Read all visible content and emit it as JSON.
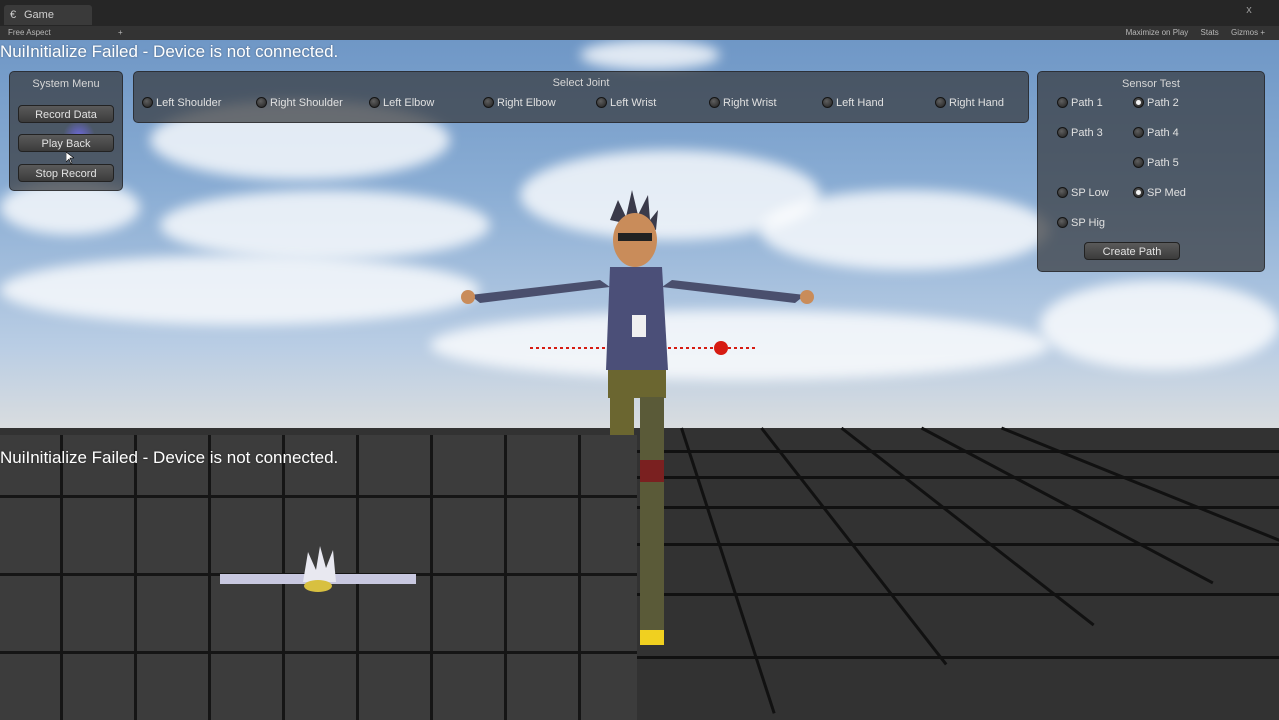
{
  "window": {
    "tab_label": "Game",
    "tab_icon": "€",
    "close_glyph": "x"
  },
  "toolbar": {
    "aspect": "Free Aspect",
    "aspect_arrow": "+",
    "maximize": "Maximize on Play",
    "stats": "Stats",
    "gizmos": "Gizmos +"
  },
  "status": {
    "error_main": "NuiInitialize Failed - Device is not connected.",
    "error_minimap": "NuiInitialize Failed - Device is not connected."
  },
  "system_menu": {
    "title": "System Menu",
    "buttons": [
      "Record Data",
      "Play Back",
      "Stop Record"
    ]
  },
  "select_joint": {
    "title": "Select Joint",
    "options": [
      {
        "label": "Left Shoulder",
        "selected": false
      },
      {
        "label": "Right Shoulder",
        "selected": false
      },
      {
        "label": "Left Elbow",
        "selected": false
      },
      {
        "label": "Right Elbow",
        "selected": false
      },
      {
        "label": "Left Wrist",
        "selected": false
      },
      {
        "label": "Right Wrist",
        "selected": false
      },
      {
        "label": "Left Hand",
        "selected": false
      },
      {
        "label": "Right Hand",
        "selected": false
      }
    ]
  },
  "sensor_test": {
    "title": "Sensor Test",
    "paths": [
      {
        "label": "Path 1",
        "selected": false
      },
      {
        "label": "Path 2",
        "selected": true
      },
      {
        "label": "Path 3",
        "selected": false
      },
      {
        "label": "Path 4",
        "selected": false
      },
      {
        "label": "Path 5",
        "selected": false
      }
    ],
    "speeds": [
      {
        "label": "SP Low",
        "selected": false
      },
      {
        "label": "SP Med",
        "selected": true
      },
      {
        "label": "SP Hig",
        "selected": false
      }
    ],
    "create_button": "Create Path"
  },
  "colors": {
    "path_marker": "#d61b12",
    "panel_bg": "#373a3e",
    "floor_line": "#111111"
  }
}
